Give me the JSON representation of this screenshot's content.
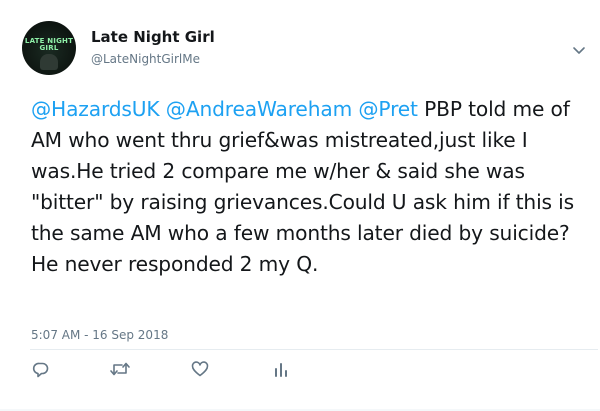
{
  "author": {
    "display_name": "Late Night Girl",
    "handle": "@LateNightGirlMe",
    "avatar_text_line1": "LATE NIGHT",
    "avatar_text_line2": "GIRL"
  },
  "tweet": {
    "mention1": "@HazardsUK",
    "mention2": "@AndreaWareham",
    "mention3": "@Pret",
    "body": "PBP told me of AM who went thru grief&was mistreated,just like I was.He tried 2 compare me w/her & said she was \"bitter\" by raising grievances.Could U ask him if this is the same AM who a few months later died by suicide? He never responded 2 my Q.",
    "timestamp": "5:07 AM - 16 Sep 2018"
  },
  "actions": {
    "reply_icon": "reply-icon",
    "retweet_icon": "retweet-icon",
    "like_icon": "heart-icon",
    "analytics_icon": "analytics-icon"
  },
  "colors": {
    "mention": "#1da1f2",
    "text": "#14171a",
    "meta": "#657786",
    "icon": "#657786",
    "avatar_accent": "#8ff0a8"
  }
}
